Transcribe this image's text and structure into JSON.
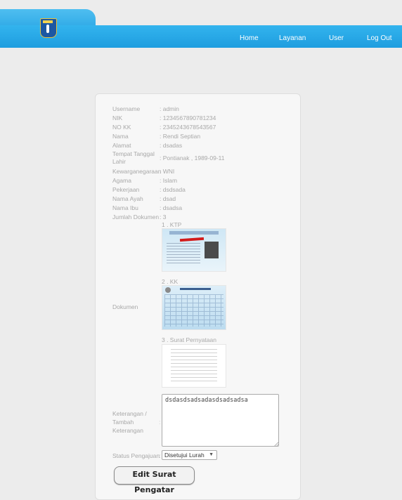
{
  "nav": {
    "items": [
      "Home",
      "Layanan",
      "User",
      "Log Out"
    ]
  },
  "profile": [
    {
      "label": "Username",
      "value": ": admin"
    },
    {
      "label": "NIK",
      "value": ": 1234567890781234"
    },
    {
      "label": "NO KK",
      "value": ": 2345243678543567"
    },
    {
      "label": "Nama",
      "value": ": Rendi Septian"
    },
    {
      "label": "Alamat",
      "value": ": dsadas"
    },
    {
      "label": "Tempat Tanggal Lahir",
      "value": ": Pontianak , 1989-09-11"
    },
    {
      "label": "Kewarganegaraan",
      "value": ": WNI"
    },
    {
      "label": "Agama",
      "value": ": Islam"
    },
    {
      "label": "Pekerjaan",
      "value": ": dsdsada"
    },
    {
      "label": "Nama Ayah",
      "value": ": dsad"
    },
    {
      "label": "Nama Ibu",
      "value": ": dsadsa"
    },
    {
      "label": "Jumlah Dokumen",
      "value": ": 3"
    }
  ],
  "documents": {
    "label": "Dokumen",
    "items": [
      "1 . KTP",
      "2 . KK",
      "3 . Surat Pernyataan"
    ]
  },
  "keterangan": {
    "label_line1": "Keterangan /",
    "label_line2": "Tambah",
    "label_line3": "Keterangan",
    "colon": ":",
    "value": "dsdasdsadsadasdsadsadsa"
  },
  "status": {
    "label": "Status Pengajuan",
    "colon": ":",
    "selected": "Disetujui Lurah"
  },
  "edit_button": "Edit Surat Pengatar"
}
